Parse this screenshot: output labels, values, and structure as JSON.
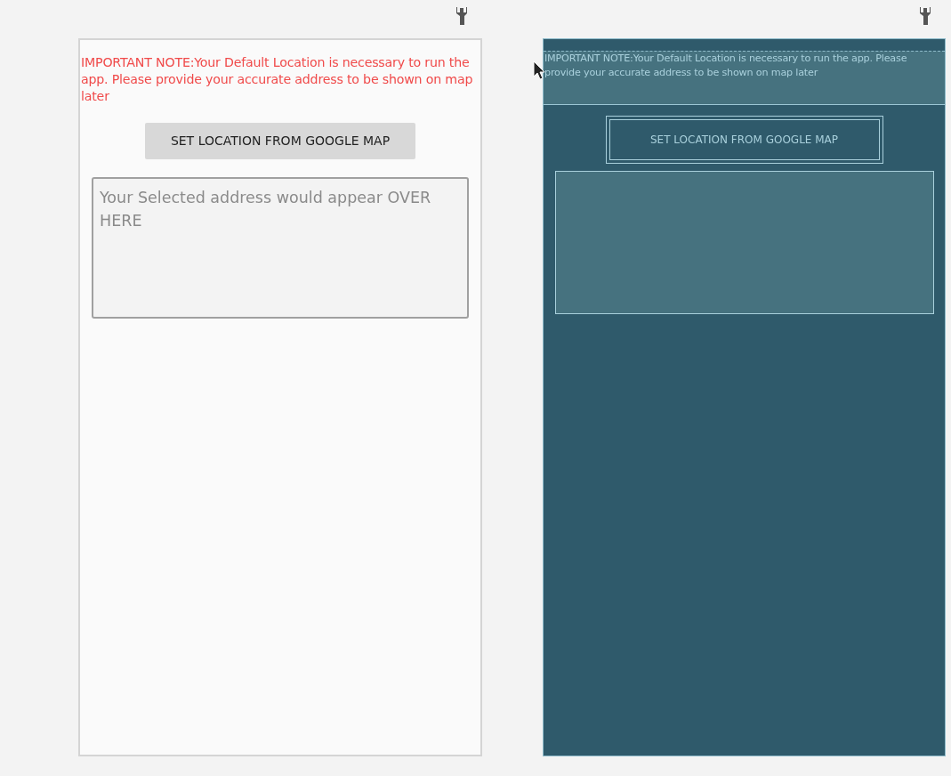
{
  "design_view": {
    "note": "IMPORTANT NOTE:Your Default Location is necessary to run the app. Please provide your accurate address to be shown on map later",
    "button": "SET LOCATION FROM GOOGLE MAP",
    "address_field": {
      "placeholder": "Your Selected address would appear OVER HERE"
    }
  },
  "blueprint_view": {
    "note": "IMPORTANT NOTE:Your Default Location is necessary to run the app. Please provide your accurate address to be shown on map later",
    "button": "SET LOCATION FROM GOOGLE MAP"
  }
}
